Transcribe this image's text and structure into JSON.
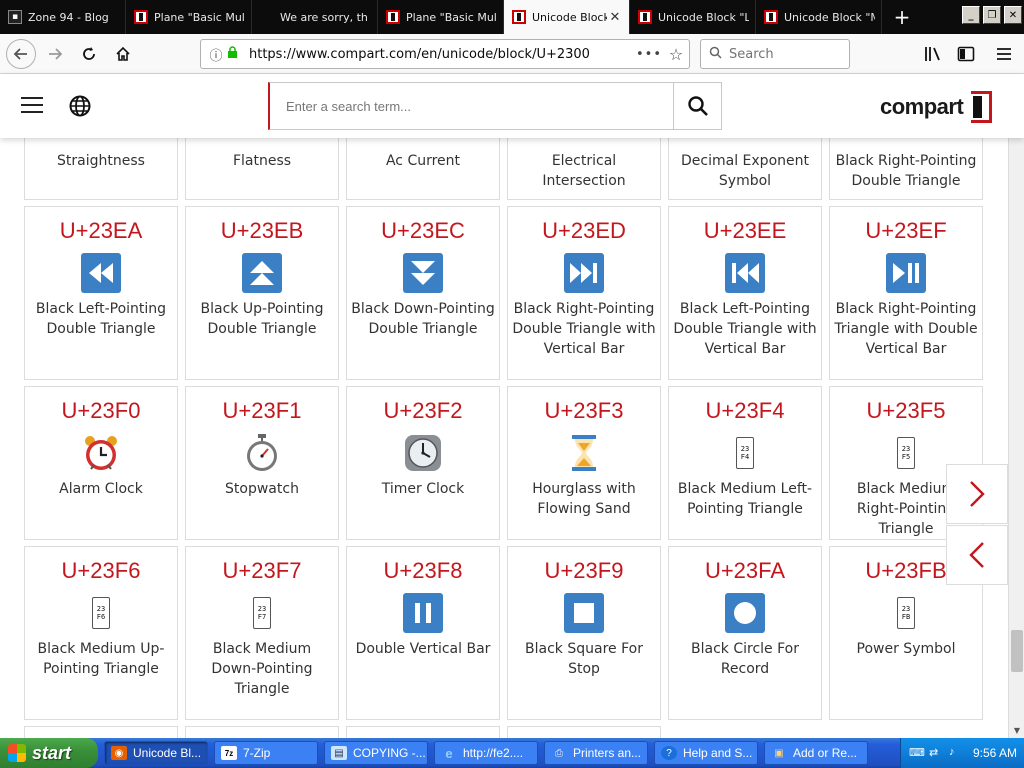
{
  "browser": {
    "tabs": [
      {
        "label": "Zone 94 - Blog",
        "icon": "blog-favicon",
        "active": false
      },
      {
        "label": "Plane \"Basic Multi",
        "icon": "compart-favicon",
        "active": false
      },
      {
        "label": "We are sorry, th",
        "icon": "microsoft-favicon",
        "active": false
      },
      {
        "label": "Plane \"Basic Multi",
        "icon": "compart-favicon",
        "active": false
      },
      {
        "label": "Unicode Block",
        "icon": "compart-favicon",
        "active": true
      },
      {
        "label": "Unicode Block \"Le",
        "icon": "compart-favicon",
        "active": false
      },
      {
        "label": "Unicode Block \"Ma",
        "icon": "compart-favicon",
        "active": false
      }
    ],
    "new_tab": "+",
    "close_tab": "✕",
    "url": "https://www.compart.com/en/unicode/block/U+2300",
    "page_actions": "•••",
    "search_placeholder": "Search"
  },
  "site": {
    "search_placeholder": "Enter a search term...",
    "logo_text": "compart"
  },
  "cards": [
    {
      "code": "",
      "name": "Straightness"
    },
    {
      "code": "",
      "name": "Flatness"
    },
    {
      "code": "",
      "name": "Ac Current"
    },
    {
      "code": "",
      "name": "Electrical Intersection"
    },
    {
      "code": "",
      "name": "Decimal Exponent Symbol"
    },
    {
      "code": "",
      "name": "Black Right-Pointing Double Triangle"
    },
    {
      "code": "U+23EA",
      "name": "Black Left-Pointing Double Triangle",
      "glyph": "rewind-icon"
    },
    {
      "code": "U+23EB",
      "name": "Black Up-Pointing Double Triangle",
      "glyph": "double-up-icon"
    },
    {
      "code": "U+23EC",
      "name": "Black Down-Pointing Double Triangle",
      "glyph": "double-down-icon"
    },
    {
      "code": "U+23ED",
      "name": "Black Right-Pointing Double Triangle with Vertical Bar",
      "glyph": "next-track-icon"
    },
    {
      "code": "U+23EE",
      "name": "Black Left-Pointing Double Triangle with Vertical Bar",
      "glyph": "previous-track-icon"
    },
    {
      "code": "U+23EF",
      "name": "Black Right-Pointing Triangle with Double Vertical Bar",
      "glyph": "play-pause-icon"
    },
    {
      "code": "U+23F0",
      "name": "Alarm Clock",
      "glyph": "alarm-clock-icon"
    },
    {
      "code": "U+23F1",
      "name": "Stopwatch",
      "glyph": "stopwatch-icon"
    },
    {
      "code": "U+23F2",
      "name": "Timer Clock",
      "glyph": "timer-clock-icon"
    },
    {
      "code": "U+23F3",
      "name": "Hourglass with Flowing Sand",
      "glyph": "hourglass-icon"
    },
    {
      "code": "U+23F4",
      "name": "Black Medium Left-Pointing Triangle",
      "glyph": "missing-glyph",
      "tofu": "23\nF4"
    },
    {
      "code": "U+23F5",
      "name": "Black Medium Right-Pointing Triangle",
      "glyph": "missing-glyph",
      "tofu": "23\nF5"
    },
    {
      "code": "U+23F6",
      "name": "Black Medium Up-Pointing Triangle",
      "glyph": "missing-glyph",
      "tofu": "23\nF6"
    },
    {
      "code": "U+23F7",
      "name": "Black Medium Down-Pointing Triangle",
      "glyph": "missing-glyph",
      "tofu": "23\nF7"
    },
    {
      "code": "U+23F8",
      "name": "Double Vertical Bar",
      "glyph": "pause-icon"
    },
    {
      "code": "U+23F9",
      "name": "Black Square For Stop",
      "glyph": "stop-icon"
    },
    {
      "code": "U+23FA",
      "name": "Black Circle For Record",
      "glyph": "record-icon"
    },
    {
      "code": "U+23FB",
      "name": "Power Symbol",
      "glyph": "missing-glyph",
      "tofu": "23\nFB"
    }
  ],
  "nav_arrows": {
    "next": "chevron-right-icon",
    "prev": "chevron-left-icon"
  },
  "taskbar": {
    "start_label": "start",
    "tasks": [
      {
        "label": "Unicode Bl...",
        "icon": "firefox-icon",
        "active": true
      },
      {
        "label": "7-Zip",
        "icon": "7zip-icon",
        "active": false
      },
      {
        "label": "COPYING -...",
        "icon": "notepad-icon",
        "active": false
      },
      {
        "label": "http://fe2....",
        "icon": "ie-icon",
        "active": false
      },
      {
        "label": "Printers an...",
        "icon": "printer-icon",
        "active": false
      },
      {
        "label": "Help and S...",
        "icon": "help-icon",
        "active": false
      },
      {
        "label": "Add or Re...",
        "icon": "add-remove-icon",
        "active": false
      }
    ],
    "clock": "9:56 AM"
  },
  "colors": {
    "accent_red": "#c4161c",
    "glyph_blue": "#3b7fc4",
    "taskbar_blue": "#245edb"
  }
}
